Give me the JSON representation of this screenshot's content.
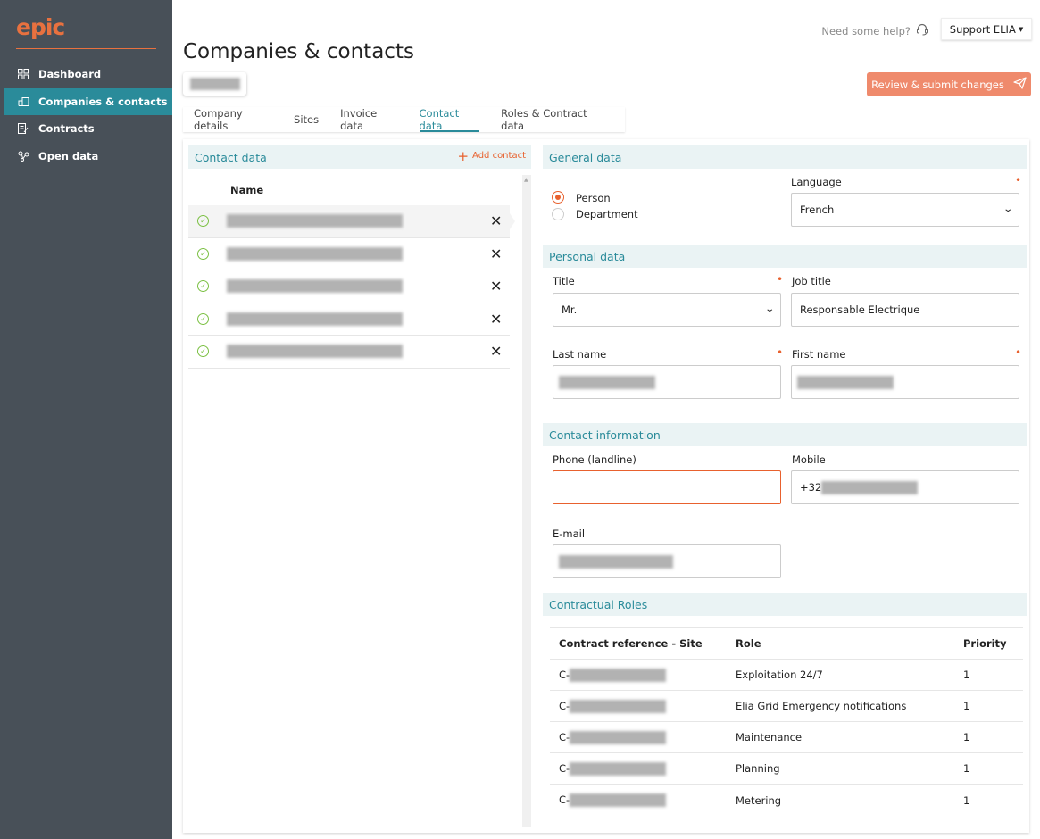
{
  "brand": {
    "logo_text": "epic"
  },
  "sidebar": {
    "items": [
      {
        "label": "Dashboard",
        "icon": "dashboard-icon",
        "active": false
      },
      {
        "label": "Companies & contacts",
        "icon": "companies-icon",
        "active": true
      },
      {
        "label": "Contracts",
        "icon": "contracts-icon",
        "active": false
      },
      {
        "label": "Open data",
        "icon": "open-data-icon",
        "active": false
      }
    ]
  },
  "header": {
    "help_text": "Need some help?",
    "support_label": "Support ELIA",
    "page_title": "Companies & contacts",
    "review_label": "Review & submit changes"
  },
  "tabs": [
    {
      "label": "Company details",
      "active": false
    },
    {
      "label": "Sites",
      "active": false
    },
    {
      "label": "Invoice data",
      "active": false
    },
    {
      "label": "Contact data",
      "active": true
    },
    {
      "label": "Roles & Contract data",
      "active": false
    }
  ],
  "contacts": {
    "title": "Contact data",
    "add_label": "Add contact",
    "column_name": "Name",
    "rows": 5
  },
  "general": {
    "title": "General data",
    "radio_person": "Person",
    "radio_department": "Department",
    "selected": "Person",
    "language_label": "Language",
    "language_value": "French"
  },
  "personal": {
    "title": "Personal data",
    "title_label": "Title",
    "title_value": "Mr.",
    "job_label": "Job title",
    "job_value": "Responsable Electrique",
    "last_label": "Last name",
    "first_label": "First name"
  },
  "contact_info": {
    "title": "Contact information",
    "phone_label": "Phone (landline)",
    "phone_value": "",
    "mobile_label": "Mobile",
    "mobile_prefix": "+32",
    "email_label": "E-mail"
  },
  "roles": {
    "title": "Contractual Roles",
    "headers": [
      "Contract reference - Site",
      "Role",
      "Priority"
    ],
    "rows": [
      {
        "ref_prefix": "C-",
        "role": "Exploitation 24/7",
        "priority": "1"
      },
      {
        "ref_prefix": "C-",
        "role": "Elia Grid Emergency notifications",
        "priority": "1"
      },
      {
        "ref_prefix": "C-",
        "role": "Maintenance",
        "priority": "1"
      },
      {
        "ref_prefix": "C-",
        "role": "Planning",
        "priority": "1"
      },
      {
        "ref_prefix": "C-",
        "role": "Metering",
        "priority": "1"
      }
    ]
  },
  "colors": {
    "accent": "#2a8b9a",
    "orange": "#e8612e",
    "sidebar": "#485058",
    "button": "#ef8a6c"
  }
}
